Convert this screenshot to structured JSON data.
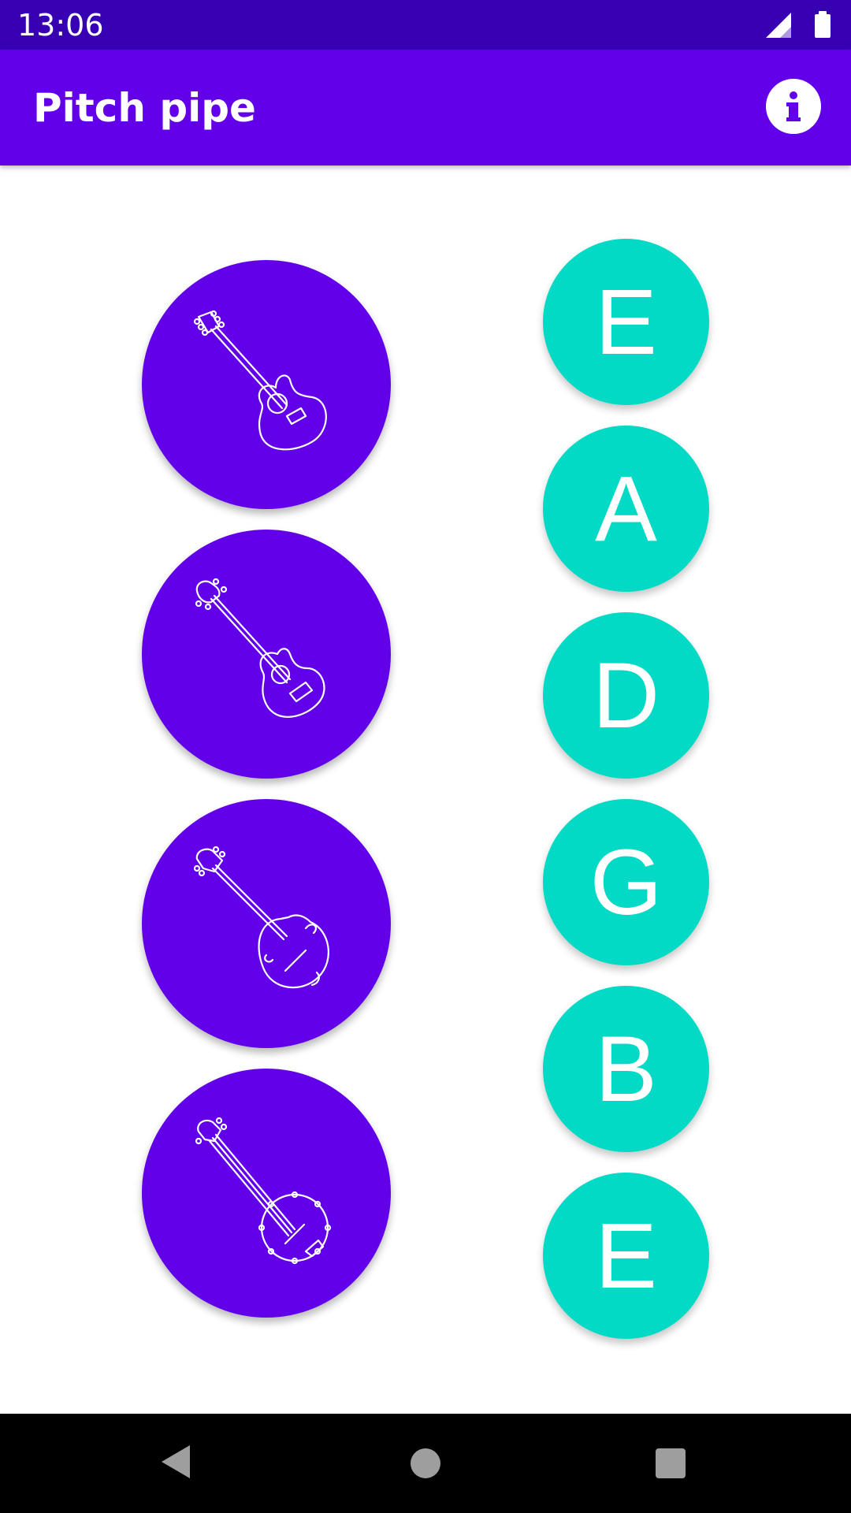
{
  "status_bar": {
    "time": "13:06",
    "icons": [
      "signal-icon",
      "battery-icon"
    ]
  },
  "app_bar": {
    "title": "Pitch pipe",
    "info_icon": "info-icon"
  },
  "instruments": [
    {
      "name": "guitar",
      "icon": "guitar-icon"
    },
    {
      "name": "ukulele",
      "icon": "ukulele-icon"
    },
    {
      "name": "mandolin",
      "icon": "mandolin-icon"
    },
    {
      "name": "banjo",
      "icon": "banjo-icon"
    }
  ],
  "notes": [
    "E",
    "A",
    "D",
    "G",
    "B",
    "E"
  ],
  "colors": {
    "status_bar": "#3700b3",
    "primary": "#6200ea",
    "accent": "#03dac5",
    "nav_bar": "#000000"
  },
  "nav_bar": {
    "back_icon": "back-icon",
    "home_icon": "home-icon",
    "recents_icon": "recents-icon"
  }
}
